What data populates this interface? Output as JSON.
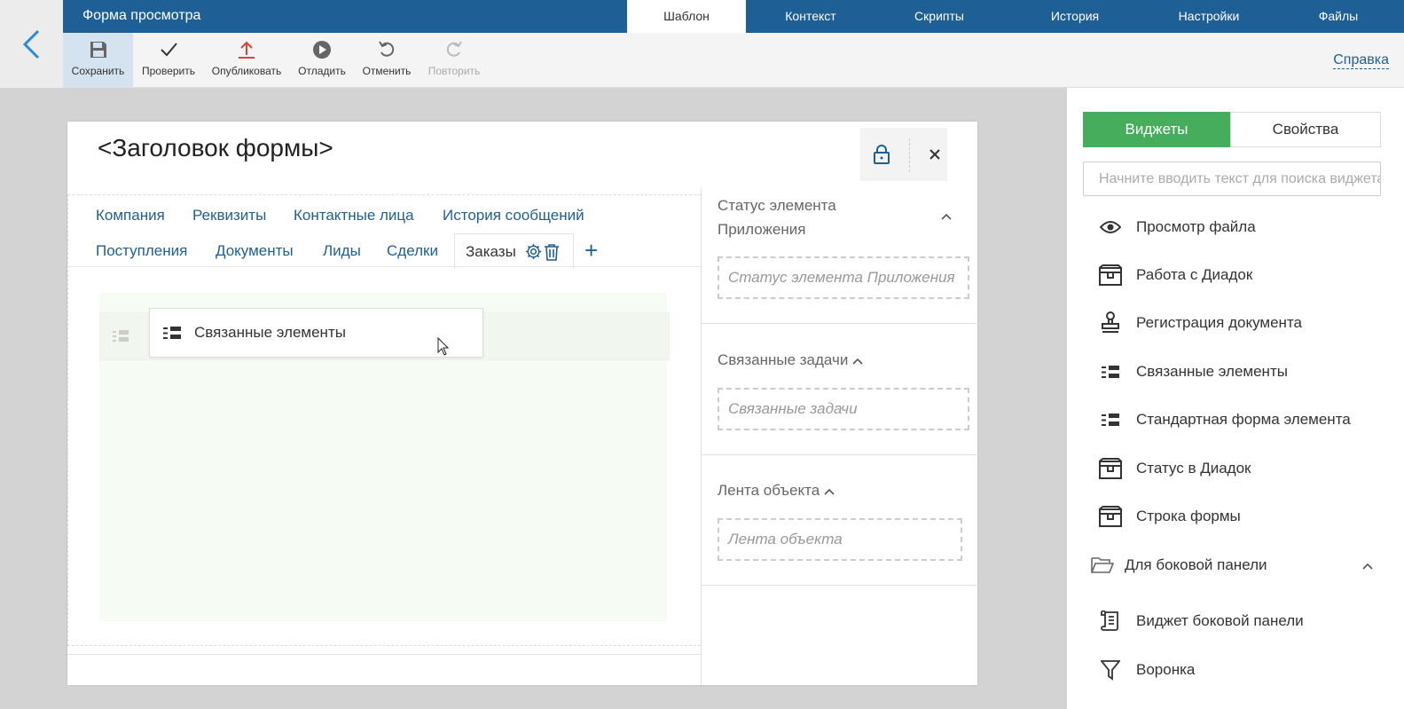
{
  "topnav": {
    "app_title": "Форма просмотра",
    "tabs": [
      "Шаблон",
      "Контекст",
      "Скрипты",
      "История",
      "Настройки",
      "Файлы"
    ],
    "active_tab": "Шаблон"
  },
  "toolbar": {
    "save": "Сохранить",
    "check": "Проверить",
    "publish": "Опубликовать",
    "debug": "Отладить",
    "undo": "Отменить",
    "redo": "Повторить",
    "help": "Справка"
  },
  "form": {
    "title": "<Заголовок формы>",
    "tabs_row1": [
      "Компания",
      "Реквизиты",
      "Контактные лица",
      "История сообщений"
    ],
    "tabs_row2": [
      "Поступления",
      "Документы",
      "Лиды",
      "Сделки"
    ],
    "selected_tab": "Заказы",
    "add_tab": "+",
    "dragged_widget": "Связанные элементы"
  },
  "right_column": {
    "sections": [
      {
        "title": "Статус элемента Приложения",
        "placeholder": "Статус элемента Приложения"
      },
      {
        "title": "Связанные задачи",
        "placeholder": "Связанные задачи"
      },
      {
        "title": "Лента объекта",
        "placeholder": "Лента объекта"
      }
    ]
  },
  "panel": {
    "tab_widgets": "Виджеты",
    "tab_properties": "Свойства",
    "search_placeholder": "Начните вводить текст для поиска виджета",
    "items": [
      {
        "label": "Просмотр файла",
        "icon": "eye-icon"
      },
      {
        "label": "Работа с Диадок",
        "icon": "box-icon"
      },
      {
        "label": "Регистрация документа",
        "icon": "stamp-icon"
      },
      {
        "label": "Связанные элементы",
        "icon": "list-icon"
      },
      {
        "label": "Стандартная форма элемента",
        "icon": "list-icon"
      },
      {
        "label": "Статус в Диадок",
        "icon": "box-icon"
      },
      {
        "label": "Строка формы",
        "icon": "box-icon"
      }
    ],
    "folder": "Для боковой панели",
    "folder_items": [
      {
        "label": "Виджет боковой панели",
        "icon": "scroll-icon"
      },
      {
        "label": "Воронка",
        "icon": "funnel-icon"
      }
    ]
  },
  "colors": {
    "nav": "#1e5f96",
    "accent_green": "#45ad5b",
    "link": "#1e5f96"
  }
}
